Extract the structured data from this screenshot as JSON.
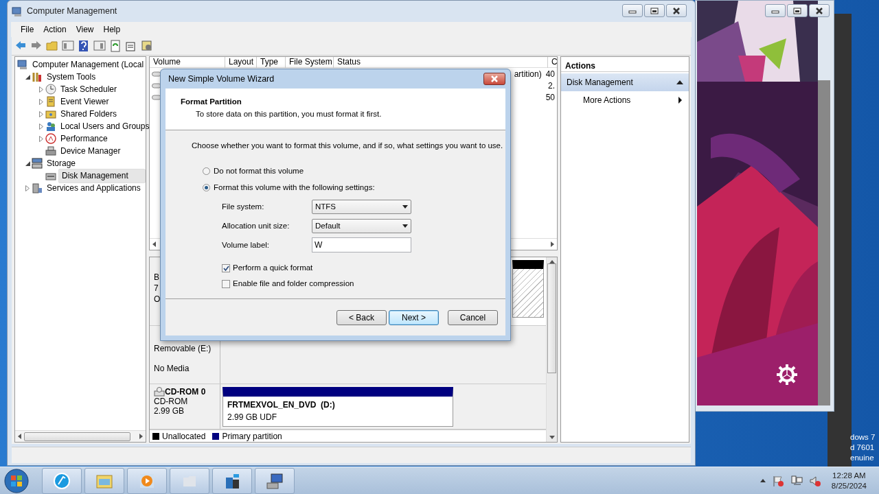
{
  "window": {
    "title": "Computer Management"
  },
  "menu": [
    "File",
    "Action",
    "View",
    "Help"
  ],
  "tree": {
    "items": [
      {
        "label": "Computer Management (Local",
        "selected": false,
        "children": [
          {
            "label": "System Tools",
            "selected": false,
            "expanded": true,
            "children": [
              {
                "label": "Task Scheduler",
                "selected": false,
                "expanded": false
              },
              {
                "label": "Event Viewer",
                "selected": false,
                "expanded": false
              },
              {
                "label": "Shared Folders",
                "selected": false,
                "expanded": false
              },
              {
                "label": "Local Users and Groups",
                "selected": false,
                "expanded": false
              },
              {
                "label": "Performance",
                "selected": false,
                "expanded": false
              },
              {
                "label": "Device Manager",
                "selected": false
              }
            ]
          },
          {
            "label": "Storage",
            "selected": false,
            "expanded": true,
            "children": [
              {
                "label": "Disk Management",
                "selected": true
              }
            ]
          },
          {
            "label": "Services and Applications",
            "selected": false,
            "expanded": false
          }
        ]
      }
    ]
  },
  "volume_table": {
    "columns": [
      "Volume",
      "Layout",
      "Type",
      "File System",
      "Status",
      "C"
    ],
    "rows": [
      {
        "status": "artition)",
        "column_6": "40"
      },
      {
        "column_6": "2."
      },
      {
        "column_6": "50"
      }
    ]
  },
  "disks": [
    {
      "kind": "partial",
      "lines": [
        "B",
        "7",
        "O"
      ]
    },
    {
      "kind": "empty",
      "type": "Removable (E:)",
      "status": "No Media"
    },
    {
      "kind": "disc",
      "title": "CD-ROM 0",
      "type": "CD-ROM",
      "size": "2.99 GB",
      "partition": {
        "name": "FRTMEXVOL_EN_DVD  (D:)",
        "info": "2.99 GB UDF"
      }
    }
  ],
  "legend": [
    {
      "label": "Unallocated",
      "color": "#000000"
    },
    {
      "label": "Primary partition",
      "color": "#000080"
    }
  ],
  "actions": {
    "title": "Actions",
    "section": "Disk Management",
    "items": [
      "More Actions"
    ]
  },
  "wizard": {
    "title": "New Simple Volume Wizard",
    "heading": "Format Partition",
    "subheading": "To store data on this partition, you must format it first.",
    "prompt": "Choose whether you want to format this volume, and if so, what settings you want to use.",
    "options": [
      {
        "label": "Do not format this volume",
        "selected": false
      },
      {
        "label": "Format this volume with the following settings:",
        "selected": true
      }
    ],
    "fields": [
      {
        "kind": "select",
        "label": "File system:",
        "value": "NTFS"
      },
      {
        "kind": "select",
        "label": "Allocation unit size:",
        "value": "Default"
      },
      {
        "kind": "text",
        "label": "Volume label:",
        "value": "W"
      }
    ],
    "checkboxes": [
      {
        "label": "Perform a quick format",
        "checked": true
      },
      {
        "label": "Enable file and folder compression",
        "checked": false
      }
    ],
    "buttons": [
      {
        "label": "< Back",
        "default": false
      },
      {
        "label": "Next >",
        "default": true
      },
      {
        "label": "Cancel",
        "default": false
      }
    ]
  },
  "desktop_text": [
    "dows 7",
    "d 7601",
    "enuine"
  ],
  "clock": {
    "time": "12:28 AM",
    "date": "8/25/2024"
  }
}
